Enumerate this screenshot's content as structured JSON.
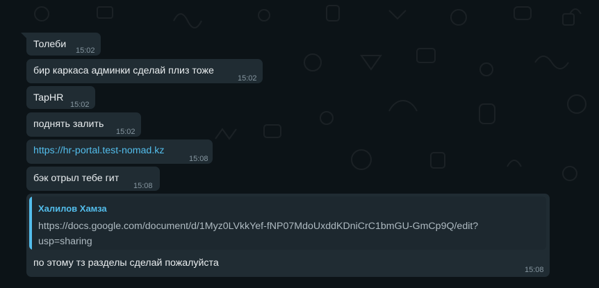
{
  "messages": [
    {
      "text": "Толеби",
      "time": "15:02"
    },
    {
      "text": "бир каркаса админки сделай плиз тоже",
      "time": "15:02"
    },
    {
      "text": "TapHR",
      "time": "15:02"
    },
    {
      "text": "поднять залить",
      "time": "15:02"
    },
    {
      "text": "https://hr-portal.test-nomad.kz",
      "time": "15:08"
    },
    {
      "text": "бэк отрыл тебе гит",
      "time": "15:08"
    }
  ],
  "reply_message": {
    "quote_author": "Халилов Хамза",
    "quote_line_1": "https://docs.google.com/document/d/1Myz0LVkkYef-fNP07MdoUxddKDniCrC1bmGU-GmCp9Q/edit?",
    "quote_line_2": "usp=sharing",
    "text": "по этому тз разделы сделай пожалуйста",
    "time": "15:08"
  },
  "colors": {
    "background": "#0c1317",
    "bubble": "#202c33",
    "link": "#53bdeb",
    "quote_bar": "#53bdeb"
  }
}
